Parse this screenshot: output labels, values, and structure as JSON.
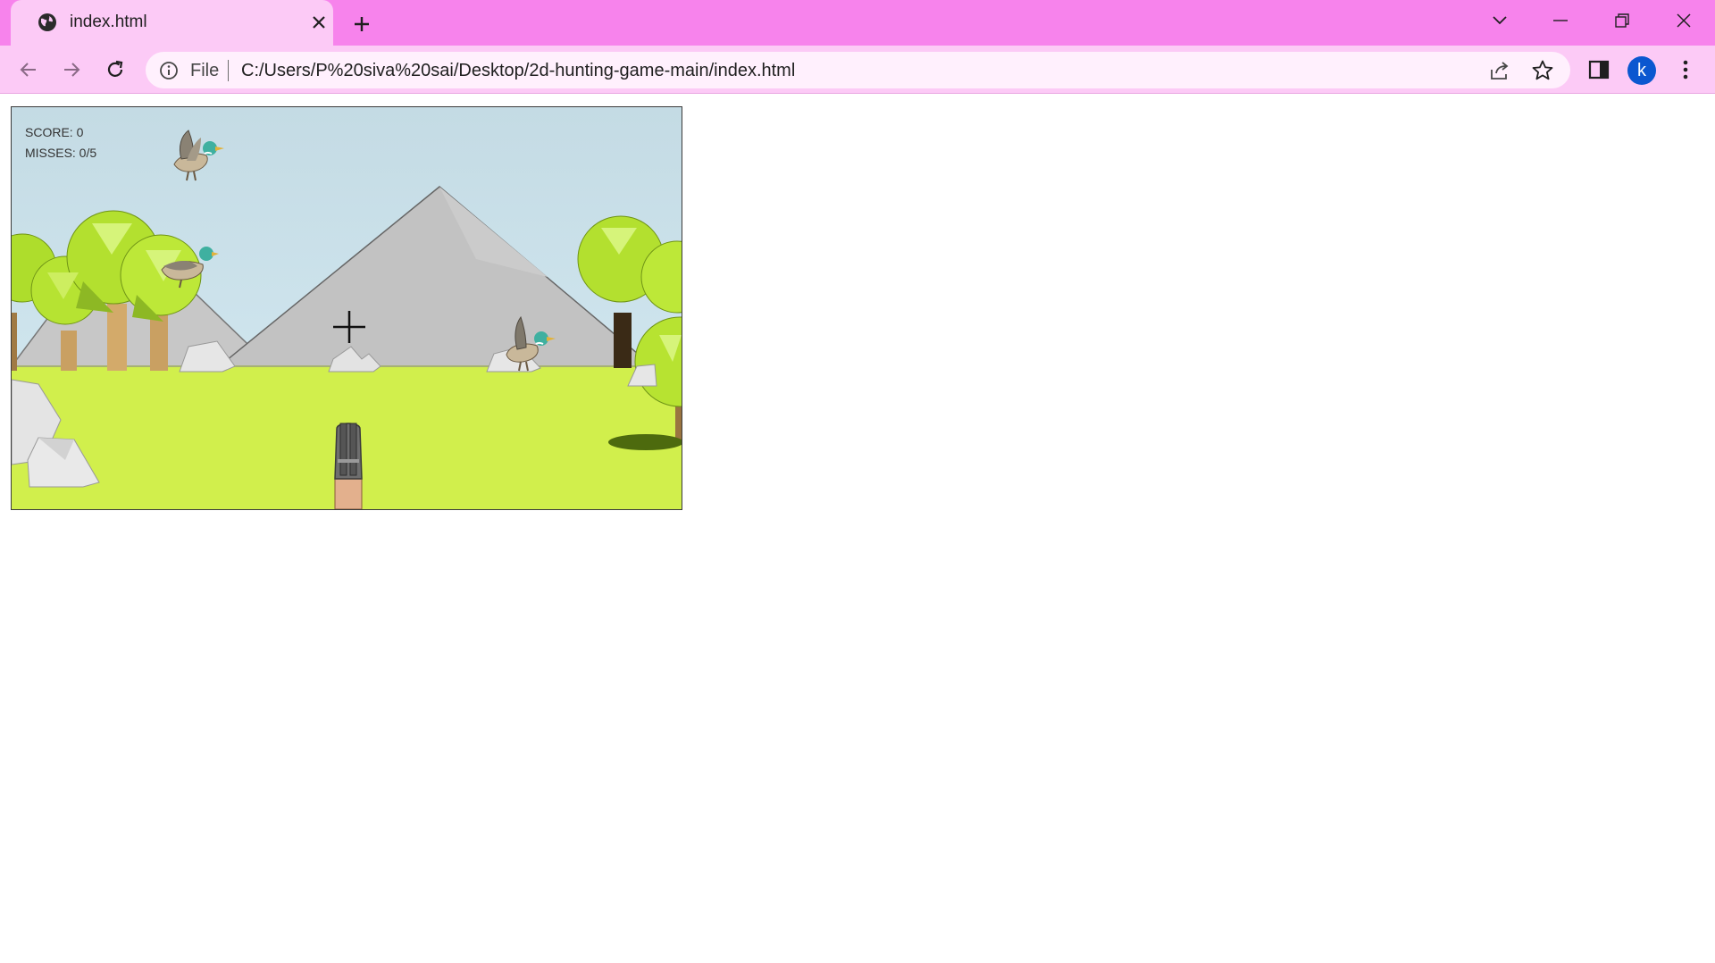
{
  "browser": {
    "tab": {
      "title": "index.html",
      "favicon": "globe-icon"
    },
    "address": {
      "scheme_label": "File",
      "url": "C:/Users/P%20siva%20sai/Desktop/2d-hunting-game-main/index.html"
    },
    "profile_initial": "k",
    "colors": {
      "tabstrip": "#f783ec",
      "toolbar": "#fccaf6",
      "omnibox": "#fff0fd",
      "avatar": "#0b57d0"
    }
  },
  "game": {
    "hud": {
      "score_text": "SCORE: 0",
      "misses_text": "MISSES: 0/5"
    },
    "ducks": [
      {
        "name": "duck-1",
        "facing": "right"
      },
      {
        "name": "duck-2",
        "facing": "right"
      },
      {
        "name": "duck-3",
        "facing": "right"
      }
    ],
    "colors": {
      "sky": "#c5dde6",
      "mountain": "#c4c4c4",
      "grass": "#d3ef4a",
      "foliage": "#b5e62e",
      "trunk": "#caa265"
    }
  }
}
